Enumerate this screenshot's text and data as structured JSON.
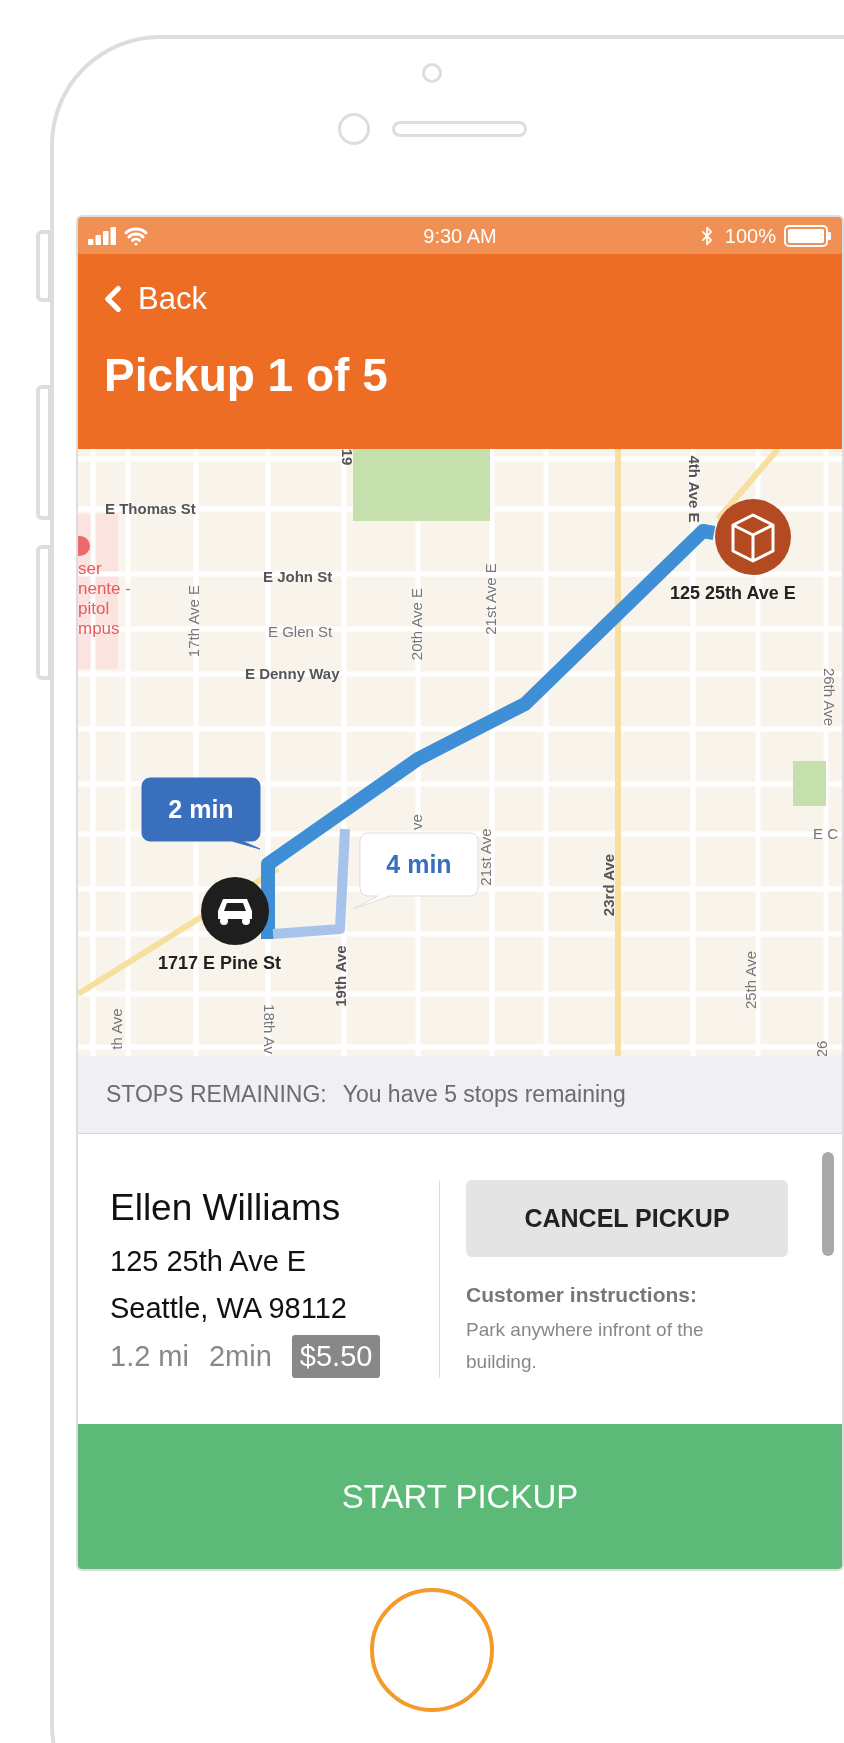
{
  "status_bar": {
    "time": "9:30 AM",
    "battery": "100%"
  },
  "nav": {
    "back": "Back",
    "title": "Pickup 1 of 5"
  },
  "map": {
    "street_labels": [
      "19",
      "E Thomas St",
      "4th Ave E",
      "E John St",
      "17th Ave E",
      "20th Ave E",
      "21st Ave E",
      "E Glen St",
      "E Denny Way",
      "26th Ave",
      "ve",
      "21st Ave",
      "23rd Ave",
      "E C",
      "19th Ave",
      "18th Av",
      "th Ave",
      "25th Ave",
      "26"
    ],
    "poi_label": [
      "ser",
      "nente -",
      "pitol",
      "mpus"
    ],
    "destination_label": "125 25th Ave E",
    "origin_label": "1717 E Pine St",
    "routes": [
      {
        "eta": "2 min",
        "selected": true
      },
      {
        "eta": "4 min",
        "selected": false
      }
    ]
  },
  "stops_banner": {
    "label": "STOPS REMAINING:",
    "text": "You have 5 stops remaining"
  },
  "customer": {
    "name": "Ellen Williams",
    "address_lines": [
      "125 25th Ave E",
      "Seattle, WA 98112"
    ],
    "distance": "1.2 mi",
    "duration": "2min",
    "fare": "$5.50"
  },
  "cancel_button": "CANCEL PICKUP",
  "instructions": {
    "title": "Customer instructions:",
    "text": "Park anywhere infront of the building."
  },
  "start_button": "START PICKUP"
}
